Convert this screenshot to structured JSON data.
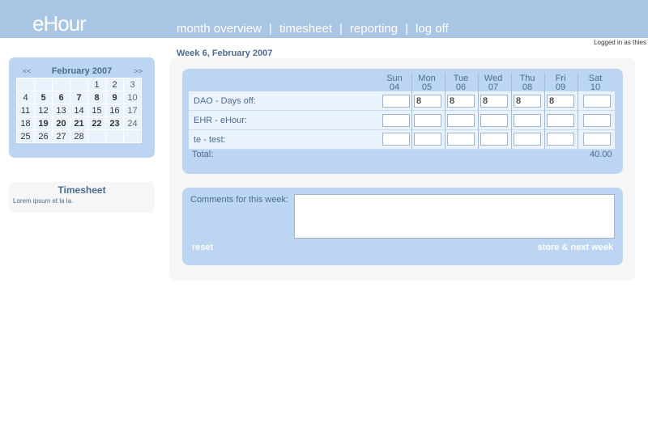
{
  "header": {
    "logo": "eHour",
    "nav": [
      {
        "label": "month overview"
      },
      {
        "label": "timesheet"
      },
      {
        "label": "reporting"
      },
      {
        "label": "log off"
      }
    ],
    "separator": "|",
    "logged_in": "Logged in as thies"
  },
  "week_title": "Week 6, February 2007",
  "calendar": {
    "prev": "<<",
    "next": ">>",
    "month": "February 2007",
    "weeks": [
      [
        "",
        "",
        "",
        "",
        "1",
        "2",
        "3"
      ],
      [
        "4",
        "5",
        "6",
        "7",
        "8",
        "9",
        "10"
      ],
      [
        "11",
        "12",
        "13",
        "14",
        "15",
        "16",
        "17"
      ],
      [
        "18",
        "19",
        "20",
        "21",
        "22",
        "23",
        "24"
      ],
      [
        "25",
        "26",
        "27",
        "28",
        "",
        "",
        ""
      ]
    ]
  },
  "sidebar_box": {
    "title": "Timesheet",
    "text": "Lorem ipsum et la la."
  },
  "timesheet": {
    "days": [
      {
        "name": "Sun",
        "date": "04"
      },
      {
        "name": "Mon",
        "date": "05"
      },
      {
        "name": "Tue",
        "date": "06"
      },
      {
        "name": "Wed",
        "date": "07"
      },
      {
        "name": "Thu",
        "date": "08"
      },
      {
        "name": "Fri",
        "date": "09"
      },
      {
        "name": "Sat",
        "date": "10"
      }
    ],
    "rows": [
      {
        "label": "DAO - Days off:",
        "values": [
          "",
          "8",
          "8",
          "8",
          "8",
          "8",
          ""
        ]
      },
      {
        "label": "EHR - eHour:",
        "values": [
          "",
          "",
          "",
          "",
          "",
          "",
          ""
        ]
      },
      {
        "label": "te - test:",
        "values": [
          "",
          "",
          "",
          "",
          "",
          "",
          ""
        ]
      }
    ],
    "total_label": "Total:",
    "total_value": "40.00"
  },
  "comments": {
    "label": "Comments for this week:",
    "value": "",
    "reset_label": "reset",
    "store_label": "store & next week"
  },
  "colors": {
    "header_bg": "#a9c5e4",
    "panel_bg": "#bcd5f2",
    "row_bg": "#eaf3fc",
    "text_accent": "#4d6b90"
  }
}
